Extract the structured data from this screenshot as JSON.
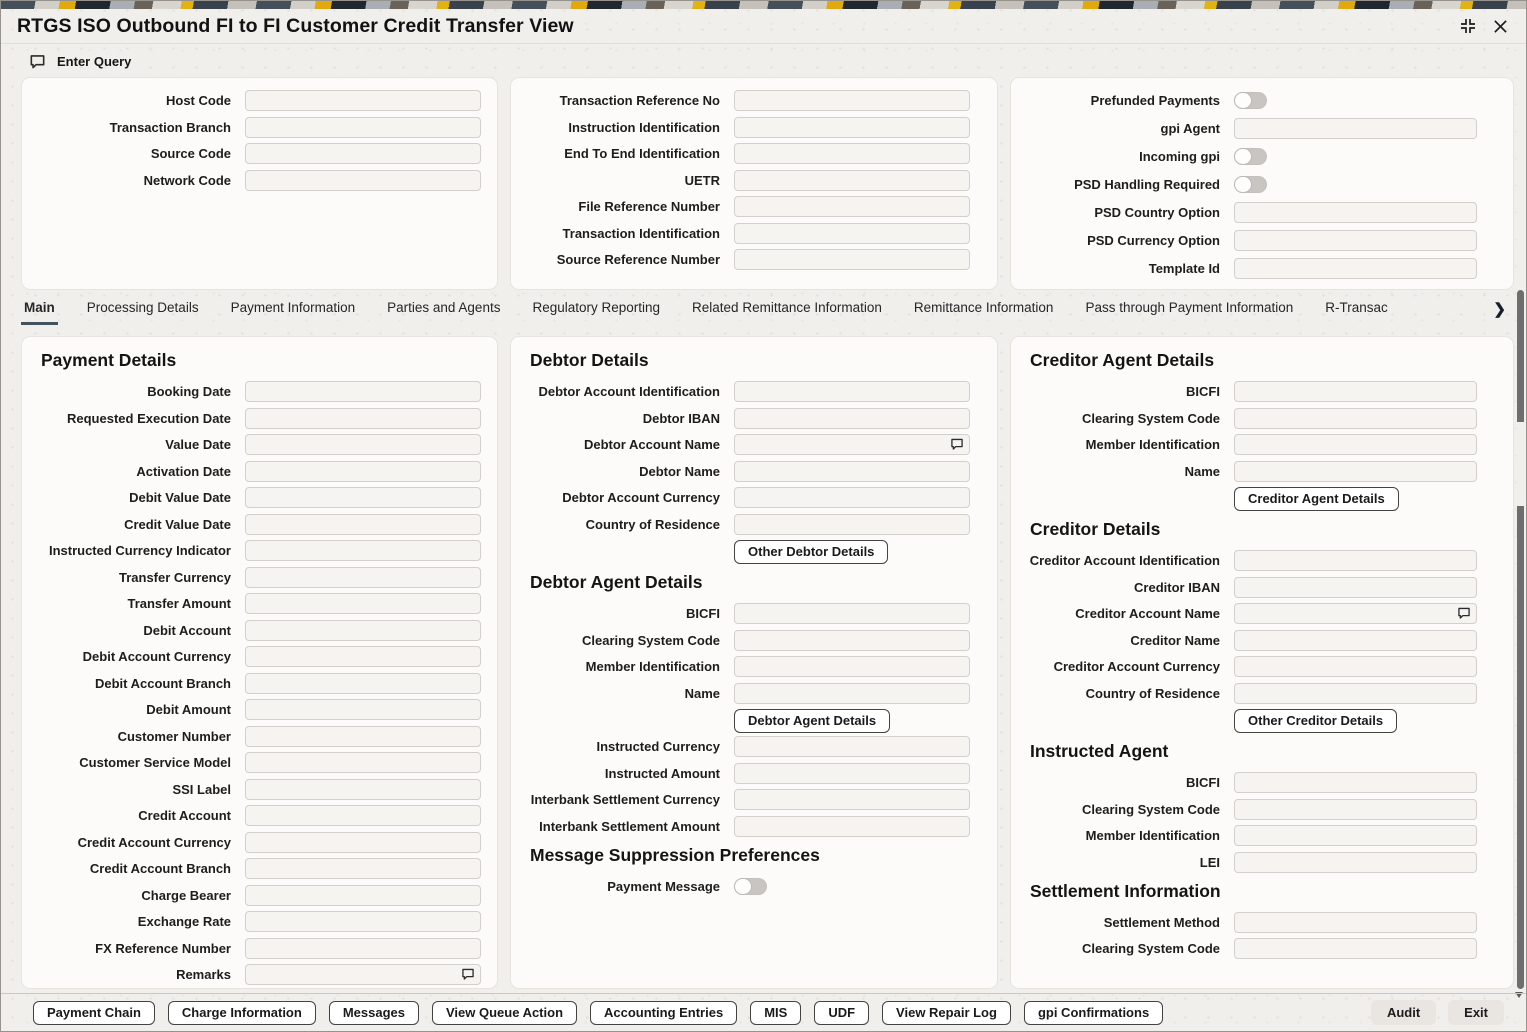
{
  "window": {
    "title": "RTGS ISO Outbound FI to FI Customer Credit Transfer View"
  },
  "toolbar": {
    "enter_query": "Enter Query"
  },
  "header_panels": {
    "left": {
      "rows": [
        {
          "label": "Host Code",
          "type": "text",
          "value": ""
        },
        {
          "label": "Transaction Branch",
          "type": "text",
          "value": ""
        },
        {
          "label": "Source Code",
          "type": "text",
          "value": ""
        },
        {
          "label": "Network Code",
          "type": "text",
          "value": ""
        }
      ]
    },
    "middle": {
      "rows": [
        {
          "label": "Transaction Reference No",
          "type": "text",
          "value": ""
        },
        {
          "label": "Instruction Identification",
          "type": "text",
          "value": ""
        },
        {
          "label": "End To End Identification",
          "type": "text",
          "value": ""
        },
        {
          "label": "UETR",
          "type": "text",
          "value": ""
        },
        {
          "label": "File Reference Number",
          "type": "text",
          "value": ""
        },
        {
          "label": "Transaction Identification",
          "type": "text",
          "value": ""
        },
        {
          "label": "Source Reference Number",
          "type": "text",
          "value": ""
        }
      ]
    },
    "right": {
      "rows": [
        {
          "label": "Prefunded Payments",
          "type": "toggle",
          "state": "off"
        },
        {
          "label": "gpi Agent",
          "type": "text",
          "value": ""
        },
        {
          "label": "Incoming gpi",
          "type": "toggle",
          "state": "off"
        },
        {
          "label": "PSD Handling Required",
          "type": "toggle",
          "state": "off"
        },
        {
          "label": "PSD Country Option",
          "type": "text",
          "value": ""
        },
        {
          "label": "PSD Currency Option",
          "type": "text",
          "value": ""
        },
        {
          "label": "Template Id",
          "type": "text",
          "value": ""
        }
      ]
    }
  },
  "tabs": {
    "items": [
      {
        "label": "Main",
        "active": true
      },
      {
        "label": "Processing Details",
        "active": false
      },
      {
        "label": "Payment Information",
        "active": false
      },
      {
        "label": "Parties and Agents",
        "active": false
      },
      {
        "label": "Regulatory Reporting",
        "active": false
      },
      {
        "label": "Related Remittance Information",
        "active": false
      },
      {
        "label": "Remittance Information",
        "active": false
      },
      {
        "label": "Pass through Payment Information",
        "active": false
      },
      {
        "label": "R-Transac",
        "active": false,
        "truncated": true
      }
    ],
    "overflow_icon": "❯"
  },
  "cards": {
    "payment": {
      "sections": [
        {
          "heading": "Payment Details",
          "rows": [
            {
              "label": "Booking Date",
              "type": "text",
              "value": ""
            },
            {
              "label": "Requested Execution Date",
              "type": "text",
              "value": ""
            },
            {
              "label": "Value Date",
              "type": "text",
              "value": ""
            },
            {
              "label": "Activation Date",
              "type": "text",
              "value": ""
            },
            {
              "label": "Debit Value Date",
              "type": "text",
              "value": ""
            },
            {
              "label": "Credit Value Date",
              "type": "text",
              "value": ""
            },
            {
              "label": "Instructed Currency Indicator",
              "type": "text",
              "value": ""
            },
            {
              "label": "Transfer Currency",
              "type": "text",
              "value": ""
            },
            {
              "label": "Transfer Amount",
              "type": "text",
              "value": ""
            },
            {
              "label": "Debit Account",
              "type": "text",
              "value": ""
            },
            {
              "label": "Debit Account Currency",
              "type": "text",
              "value": ""
            },
            {
              "label": "Debit Account Branch",
              "type": "text",
              "value": ""
            },
            {
              "label": "Debit Amount",
              "type": "text",
              "value": ""
            },
            {
              "label": "Customer Number",
              "type": "text",
              "value": ""
            },
            {
              "label": "Customer Service Model",
              "type": "text",
              "value": ""
            },
            {
              "label": "SSI Label",
              "type": "text",
              "value": ""
            },
            {
              "label": "Credit Account",
              "type": "text",
              "value": ""
            },
            {
              "label": "Credit Account Currency",
              "type": "text",
              "value": ""
            },
            {
              "label": "Credit Account Branch",
              "type": "text",
              "value": ""
            },
            {
              "label": "Charge Bearer",
              "type": "text",
              "value": ""
            },
            {
              "label": "Exchange Rate",
              "type": "text",
              "value": ""
            },
            {
              "label": "FX Reference Number",
              "type": "text",
              "value": ""
            },
            {
              "label": "Remarks",
              "type": "comment",
              "value": ""
            }
          ]
        }
      ]
    },
    "debtor": {
      "sections": [
        {
          "heading": "Debtor Details",
          "rows": [
            {
              "label": "Debtor Account Identification",
              "type": "text",
              "value": ""
            },
            {
              "label": "Debtor IBAN",
              "type": "text",
              "value": ""
            },
            {
              "label": "Debtor Account Name",
              "type": "comment",
              "value": ""
            },
            {
              "label": "Debtor Name",
              "type": "text",
              "value": ""
            },
            {
              "label": "Debtor Account Currency",
              "type": "text",
              "value": ""
            },
            {
              "label": "Country of Residence",
              "type": "text",
              "value": ""
            },
            {
              "type": "button",
              "label": "Other Debtor Details"
            }
          ]
        },
        {
          "heading": "Debtor Agent Details",
          "rows": [
            {
              "label": "BICFI",
              "type": "text",
              "value": ""
            },
            {
              "label": "Clearing System Code",
              "type": "text",
              "value": ""
            },
            {
              "label": "Member Identification",
              "type": "text",
              "value": ""
            },
            {
              "label": "Name",
              "type": "text",
              "value": ""
            },
            {
              "type": "button",
              "label": "Debtor Agent Details"
            },
            {
              "label": "Instructed Currency",
              "type": "text",
              "value": ""
            },
            {
              "label": "Instructed Amount",
              "type": "text",
              "value": ""
            },
            {
              "label": "Interbank Settlement Currency",
              "type": "text",
              "value": ""
            },
            {
              "label": "Interbank Settlement Amount",
              "type": "text",
              "value": ""
            }
          ]
        },
        {
          "heading": "Message Suppression Preferences",
          "rows": [
            {
              "label": "Payment Message",
              "type": "toggle",
              "state": "off"
            }
          ]
        }
      ]
    },
    "creditor": {
      "sections": [
        {
          "heading": "Creditor Agent Details",
          "rows": [
            {
              "label": "BICFI",
              "type": "text",
              "value": ""
            },
            {
              "label": "Clearing System Code",
              "type": "text",
              "value": ""
            },
            {
              "label": "Member Identification",
              "type": "text",
              "value": ""
            },
            {
              "label": "Name",
              "type": "text",
              "value": ""
            },
            {
              "type": "button",
              "label": "Creditor Agent Details"
            }
          ]
        },
        {
          "heading": "Creditor Details",
          "rows": [
            {
              "label": "Creditor Account Identification",
              "type": "text",
              "value": ""
            },
            {
              "label": "Creditor IBAN",
              "type": "text",
              "value": ""
            },
            {
              "label": "Creditor Account Name",
              "type": "comment",
              "value": ""
            },
            {
              "label": "Creditor Name",
              "type": "text",
              "value": ""
            },
            {
              "label": "Creditor Account Currency",
              "type": "text",
              "value": ""
            },
            {
              "label": "Country of Residence",
              "type": "text",
              "value": ""
            },
            {
              "type": "button",
              "label": "Other Creditor Details"
            }
          ]
        },
        {
          "heading": "Instructed Agent",
          "rows": [
            {
              "label": "BICFI",
              "type": "text",
              "value": ""
            },
            {
              "label": "Clearing System Code",
              "type": "text",
              "value": ""
            },
            {
              "label": "Member Identification",
              "type": "text",
              "value": ""
            },
            {
              "label": "LEI",
              "type": "text",
              "value": ""
            }
          ]
        },
        {
          "heading": "Settlement Information",
          "rows": [
            {
              "label": "Settlement Method",
              "type": "text",
              "value": ""
            },
            {
              "label": "Clearing System Code",
              "type": "text",
              "value": ""
            }
          ]
        }
      ]
    }
  },
  "footer": {
    "buttons": [
      "Payment Chain",
      "Charge Information",
      "Messages",
      "View Queue Action",
      "Accounting Entries",
      "MIS",
      "UDF",
      "View Repair Log",
      "gpi Confirmations"
    ],
    "audit": "Audit",
    "exit": "Exit"
  },
  "colors": {
    "active_tab_underline": "#44525e",
    "card_background": "#fcfbf9",
    "input_background": "#f6f4f1",
    "toggle_track": "#c9c6c2"
  }
}
